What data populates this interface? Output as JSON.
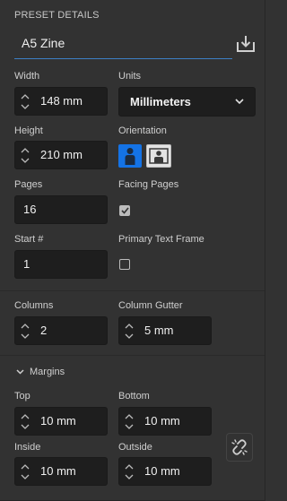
{
  "header": {
    "title": "PRESET DETAILS"
  },
  "preset": {
    "name": "A5 Zine"
  },
  "width": {
    "label": "Width",
    "value": "148 mm"
  },
  "units": {
    "label": "Units",
    "value": "Millimeters"
  },
  "height": {
    "label": "Height",
    "value": "210 mm"
  },
  "orientation": {
    "label": "Orientation",
    "selected": "portrait"
  },
  "pages": {
    "label": "Pages",
    "value": "16"
  },
  "facing_pages": {
    "label": "Facing Pages",
    "checked": true
  },
  "start": {
    "label": "Start #",
    "value": "1"
  },
  "primary_text_frame": {
    "label": "Primary Text Frame",
    "checked": false
  },
  "columns": {
    "label": "Columns",
    "value": "2"
  },
  "column_gutter": {
    "label": "Column Gutter",
    "value": "5 mm"
  },
  "margins": {
    "label": "Margins",
    "top": {
      "label": "Top",
      "value": "10 mm"
    },
    "bottom": {
      "label": "Bottom",
      "value": "10 mm"
    },
    "inside": {
      "label": "Inside",
      "value": "10 mm"
    },
    "outside": {
      "label": "Outside",
      "value": "10 mm"
    }
  },
  "colors": {
    "accent": "#1473e6",
    "panel": "#323232",
    "field": "#1e1e1e"
  }
}
